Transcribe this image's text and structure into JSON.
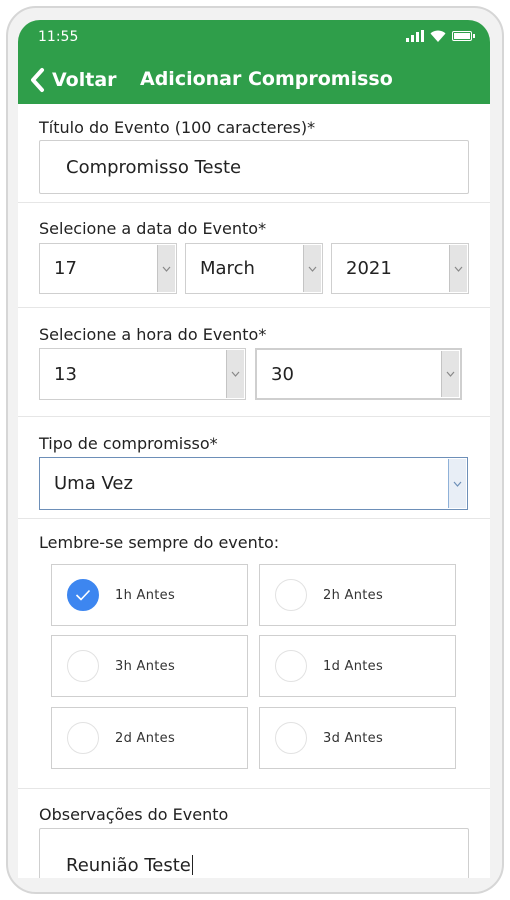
{
  "status": {
    "time": "11:55"
  },
  "header": {
    "back_label": "Voltar",
    "title": "Adicionar Compromisso",
    "color": "#2f9e4a"
  },
  "form": {
    "title_label": "Título do Evento (100 caracteres)*",
    "title_value": "Compromisso Teste",
    "date_label": "Selecione a data do Evento*",
    "day": "17",
    "month": "March",
    "year": "2021",
    "time_label": "Selecione a hora do Evento*",
    "hour": "13",
    "minute": "30",
    "type_label": "Tipo de compromisso*",
    "type_value": "Uma Vez",
    "reminder_label": "Lembre-se sempre do evento:",
    "reminders": [
      {
        "label": "1h Antes",
        "checked": true
      },
      {
        "label": "2h Antes",
        "checked": false
      },
      {
        "label": "3h Antes",
        "checked": false
      },
      {
        "label": "1d Antes",
        "checked": false
      },
      {
        "label": "2d Antes",
        "checked": false
      },
      {
        "label": "3d Antes",
        "checked": false
      }
    ],
    "notes_label": "Observações do Evento",
    "notes_value": "Reunião Teste"
  },
  "colors": {
    "checked": "#3d86f0"
  }
}
